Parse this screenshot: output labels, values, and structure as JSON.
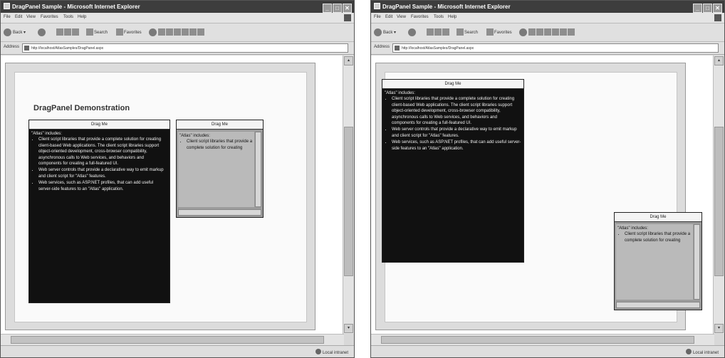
{
  "window_title": "DragPanel Sample - Microsoft Internet Explorer",
  "menu": [
    "File",
    "Edit",
    "View",
    "Favorites",
    "Tools",
    "Help"
  ],
  "toolbar": {
    "back": "Back",
    "search": "Search",
    "favorites": "Favorites"
  },
  "address": {
    "label": "Address",
    "url": "http://localhost/AtlasSamples/DragPanel.aspx"
  },
  "page_title": "DragPanel Demonstration",
  "panel": {
    "header": "Drag Me",
    "intro": "\"Atlas\" includes:",
    "items": [
      "Client script libraries that provide a complete solution for creating client-based Web applications. The client script libraries support object-oriented development, cross-browser compatibility, asynchronous calls to Web services, and behaviors and components for creating a full-featured UI.",
      "Web server controls that provide a declarative way to emit markup and client script for \"Atlas\" features.",
      "Web services, such as ASP.NET profiles, that can add useful server-side features to an \"Atlas\" application."
    ]
  },
  "mini_panel": {
    "header": "Drag Me",
    "intro": "\"Atlas\" includes:",
    "item": "Client script libraries that provide a complete solution for creating"
  },
  "status": {
    "zone": "Local intranet"
  }
}
